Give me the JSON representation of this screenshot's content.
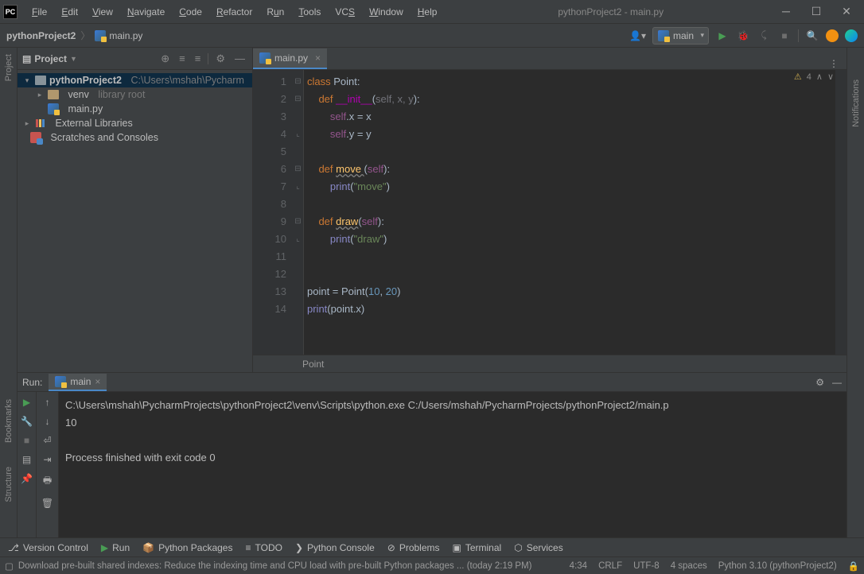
{
  "window": {
    "title": "pythonProject2 - main.py"
  },
  "menu": [
    "File",
    "Edit",
    "View",
    "Navigate",
    "Code",
    "Refactor",
    "Run",
    "Tools",
    "VCS",
    "Window",
    "Help"
  ],
  "breadcrumb": {
    "project": "pythonProject2",
    "file": "main.py"
  },
  "run_config": {
    "name": "main"
  },
  "project_panel": {
    "title": "Project",
    "root": {
      "name": "pythonProject2",
      "path": "C:\\Users\\mshah\\Pycharm"
    },
    "venv": {
      "name": "venv",
      "note": "library root"
    },
    "file": "main.py",
    "ext_lib": "External Libraries",
    "scratches": "Scratches and Consoles"
  },
  "editor": {
    "tab": "main.py",
    "warnings": "4",
    "lines": [
      1,
      2,
      3,
      4,
      5,
      6,
      7,
      8,
      9,
      10,
      11,
      12,
      13,
      14
    ],
    "breadcrumb": "Point"
  },
  "code": {
    "l1": {
      "a": "class ",
      "b": "Point",
      "c": ":"
    },
    "l2": {
      "a": "    def ",
      "b": "__init__",
      "c": "(",
      "d": "self, x, y",
      "e": "):"
    },
    "l3": {
      "a": "        ",
      "b": "self",
      "c": ".x = x"
    },
    "l4": {
      "a": "        ",
      "b": "self",
      "c": ".y = y"
    },
    "l6": {
      "a": "    def ",
      "b": "move ",
      "c": "(",
      "d": "self",
      "e": "):"
    },
    "l7": {
      "a": "        ",
      "b": "print",
      "c": "(",
      "d": "\"move\"",
      "e": ")"
    },
    "l9": {
      "a": "    def ",
      "b": "draw",
      "c": "(",
      "d": "self",
      "e": "):"
    },
    "l10": {
      "a": "        ",
      "b": "print",
      "c": "(",
      "d": "\"draw\"",
      "e": ")"
    },
    "l13": {
      "a": "point = Point(",
      "b": "10",
      "c": ", ",
      "d": "20",
      "e": ")"
    },
    "l14": {
      "a": "print",
      "b": "(point.x)"
    }
  },
  "run_panel": {
    "label": "Run:",
    "tab": "main",
    "output_line1": "C:\\Users\\mshah\\PycharmProjects\\pythonProject2\\venv\\Scripts\\python.exe C:/Users/mshah/PycharmProjects/pythonProject2/main.p",
    "output_line2": "10",
    "output_line3": "",
    "output_line4": "Process finished with exit code 0"
  },
  "bottom_tools": {
    "vc": "Version Control",
    "run": "Run",
    "pkg": "Python Packages",
    "todo": "TODO",
    "pyc": "Python Console",
    "prob": "Problems",
    "term": "Terminal",
    "svc": "Services"
  },
  "status": {
    "msg": "Download pre-built shared indexes: Reduce the indexing time and CPU load with pre-built Python packages ... (today 2:19 PM)",
    "pos": "4:34",
    "le": "CRLF",
    "enc": "UTF-8",
    "indent": "4 spaces",
    "interp": "Python 3.10 (pythonProject2)"
  },
  "sidebars": {
    "project": "Project",
    "bookmarks": "Bookmarks",
    "structure": "Structure",
    "notifications": "Notifications"
  }
}
